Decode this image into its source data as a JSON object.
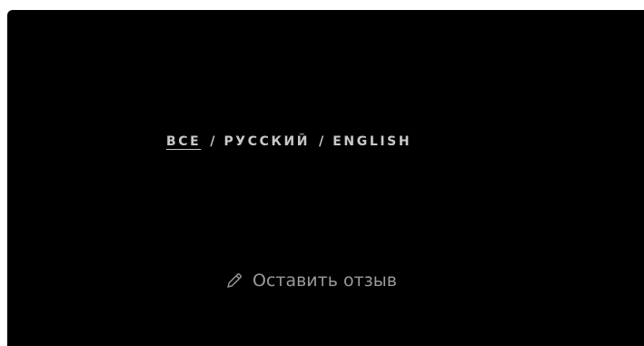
{
  "language_filter": {
    "items": [
      {
        "label": "ВСЕ",
        "active": true
      },
      {
        "label": "РУССКИЙ",
        "active": false
      },
      {
        "label": "ENGLISH",
        "active": false
      }
    ],
    "separator": "/"
  },
  "feedback": {
    "icon": "pencil-icon",
    "label": "Оставить отзыв"
  },
  "colors": {
    "panel_background": "#000000",
    "language_text": "#c9c9c9",
    "feedback_text": "#9a9a9a"
  }
}
